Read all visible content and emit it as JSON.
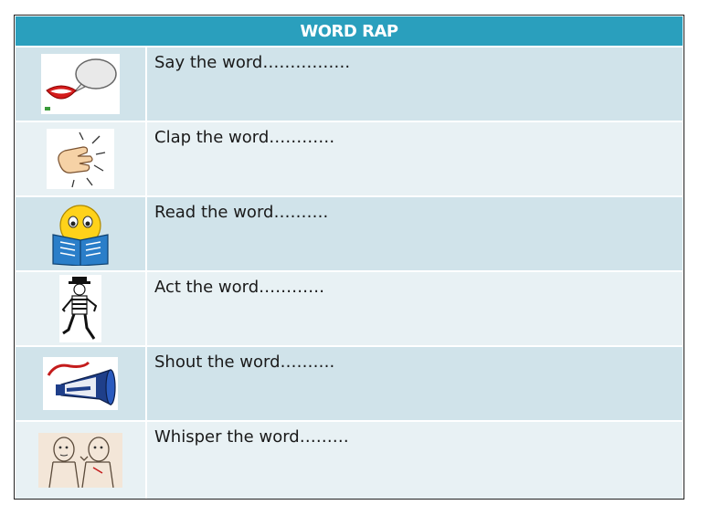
{
  "table": {
    "title": "WORD RAP",
    "rows": [
      {
        "text": "Say the word…………….",
        "icon": "mouth-speech-icon"
      },
      {
        "text": "Clap the word…………",
        "icon": "clapping-hand-icon"
      },
      {
        "text": "Read the word……….",
        "icon": "reading-smiley-icon"
      },
      {
        "text": "Act the word…………",
        "icon": "mime-actor-icon"
      },
      {
        "text": "Shout the word……….",
        "icon": "shout-out-icon"
      },
      {
        "text": "Whisper the word………",
        "icon": "whisper-people-icon"
      }
    ]
  },
  "colors": {
    "header": "#2a9fbd",
    "row_dark": "#d0e3ea",
    "row_light": "#e8f1f4"
  }
}
